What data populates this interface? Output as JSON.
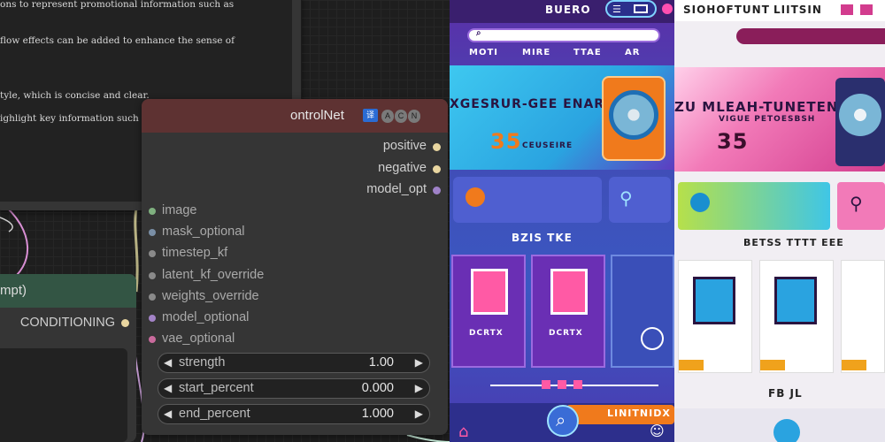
{
  "text_popup": {
    "lines": [
      "ons to represent promotional information such as",
      "flow effects can be added to enhance the sense of",
      "tyle, which is concise and clear.",
      "ighlight key information such as price tags, purchase"
    ]
  },
  "controlnet_node": {
    "title": "ontrolNet",
    "badges": [
      "A",
      "C",
      "N"
    ],
    "badge_main_icon": "translate-icon",
    "outputs": [
      {
        "label": "positive",
        "color": "#e9d6a0"
      },
      {
        "label": "negative",
        "color": "#e9d6a0"
      },
      {
        "label": "model_opt",
        "color": "#9f82c8"
      }
    ],
    "inputs": [
      {
        "label": "image",
        "color": "#7fb07f"
      },
      {
        "label": "mask_optional",
        "color": "#7a8fa6"
      },
      {
        "label": "timestep_kf",
        "color": "#8a8a8a"
      },
      {
        "label": "latent_kf_override",
        "color": "#8a8a8a"
      },
      {
        "label": "weights_override",
        "color": "#8a8a8a"
      },
      {
        "label": "model_optional",
        "color": "#a383c7"
      },
      {
        "label": "vae_optional",
        "color": "#c96a9c"
      }
    ],
    "widgets": [
      {
        "name": "strength",
        "value": "1.00"
      },
      {
        "name": "start_percent",
        "value": "0.000"
      },
      {
        "name": "end_percent",
        "value": "1.000"
      }
    ]
  },
  "prompt_node": {
    "title": "mpt)",
    "output_label": "CONDITIONING",
    "output_color": "#e9d6a0"
  },
  "store_a": {
    "header": "BUERO",
    "hero_title": "XGESRUR-GEE ENARE",
    "hero_price": "35",
    "hero_sub": "CEUSEIRE",
    "nav": [
      "MOTI",
      "MIRE",
      "TTAE",
      "AR"
    ],
    "section": "BZIS TKE",
    "card_caption": "DCRTX",
    "card_caption_2": "DCRTX",
    "banner": "LINITNIDX",
    "accent": "#f07a1c"
  },
  "store_b": {
    "header": "SIOHOFTUNT",
    "header_right": "LIITSIN",
    "hero_title": "ZU MLEAH-TUNETENALLE",
    "hero_sub": "VIGUE PETOESBSH",
    "hero_price": "35",
    "section": "BETSS TTTT EEE",
    "footer": "FB JL",
    "accent": "#d23c8e"
  }
}
